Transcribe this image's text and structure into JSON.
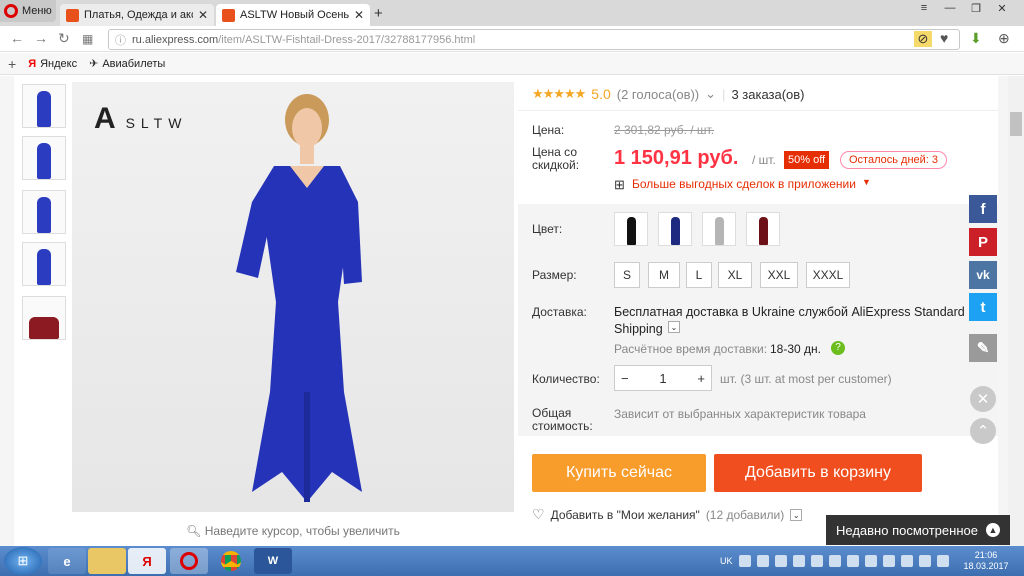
{
  "browser": {
    "menu_label": "Меню",
    "tabs": [
      {
        "title": "Платья, Одежда и аксессу"
      },
      {
        "title": "ASLTW Новый Осень Бол"
      }
    ],
    "new_tab": "+",
    "url_host": "ru.aliexpress.com",
    "url_path": "/item/ASLTW-Fishtail-Dress-2017/32788177956.html",
    "bookmarks": [
      {
        "label": "Яндекс"
      },
      {
        "label": "Авиабилеты"
      }
    ]
  },
  "gallery": {
    "brand_initial": "A",
    "brand_rest": "SLTW",
    "zoom_hint": "Наведите курсор, чтобы увеличить",
    "thumb_colors": [
      "#2b3cc0",
      "#2b3cc0",
      "#2b3cc0",
      "#2b3cc0",
      "#8b1a22"
    ]
  },
  "product": {
    "rating": "5.0",
    "votes": "(2 голоса(ов))",
    "orders": "3 заказа(ов)",
    "price_label": "Цена:",
    "old_price": "2 301,82 руб. / шт.",
    "discount_label_1": "Цена со",
    "discount_label_2": "скидкой:",
    "new_price": "1 150,91 руб.",
    "unit": "/ шт.",
    "discount_badge": "50% off",
    "days_left": "Осталось дней: 3",
    "app_deals": "Больше выгодных сделок в приложении",
    "color_label": "Цвет:",
    "colors": [
      "#111111",
      "#1e2a80",
      "#b5b5b5",
      "#6e1018"
    ],
    "size_label": "Размер:",
    "sizes": [
      "S",
      "M",
      "L",
      "XL",
      "XXL",
      "XXXL"
    ],
    "shipping_label": "Доставка:",
    "shipping_text": "Бесплатная доставка в Ukraine службой AliExpress Standard",
    "shipping_text2": "Shipping",
    "delivery_time_label": "Расчётное время доставки:",
    "delivery_time": "18-30 дн.",
    "qty_label": "Количество:",
    "qty_value": "1",
    "qty_note": "шт. (3 шт. at most per customer)",
    "total_label_1": "Общая",
    "total_label_2": "стоимость:",
    "total_note": "Зависит от выбранных характеристик товара",
    "buy_now": "Купить сейчас",
    "add_to_cart": "Добавить в корзину",
    "wishlist": "Добавить в \"Мои желания\"",
    "wishlist_count": "(12 добавили)"
  },
  "share": {
    "facebook": "f",
    "pinterest": "P",
    "vk": "vk",
    "twitter": "t",
    "colors": {
      "facebook": "#3b5998",
      "pinterest": "#cb2027",
      "vk": "#4c75a3",
      "twitter": "#1da1f2",
      "edit": "#9a9a9a"
    }
  },
  "recently_viewed": "Недавно посмотренное",
  "taskbar": {
    "lang": "UK",
    "time": "21:06",
    "date": "18.03.2017"
  }
}
